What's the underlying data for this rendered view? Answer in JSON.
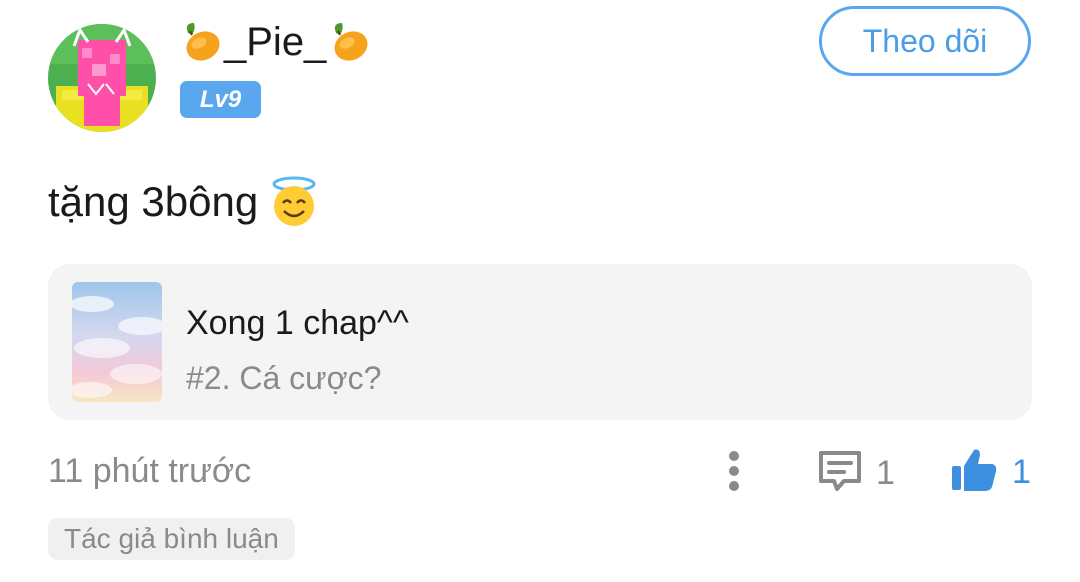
{
  "user": {
    "name": "_Pie_",
    "level": "Lv9"
  },
  "follow_button": {
    "label": "Theo dõi"
  },
  "post": {
    "text": "tặng 3bông"
  },
  "story": {
    "title": "Xong 1 chap^^",
    "chapter": "#2. Cá cược?"
  },
  "meta": {
    "time_ago": "11 phút trước",
    "comment_count": "1",
    "like_count": "1",
    "author_tag": "Tác giả bình luận"
  },
  "icons": {
    "name_decoration": "mango-icon",
    "post_emoji": "smiling-face-with-halo-icon",
    "more": "vertical-dots-icon",
    "comment": "comment-icon",
    "like": "thumbs-up-icon"
  },
  "colors": {
    "accent": "#5aa7ef",
    "like": "#3d8fe0",
    "muted_text": "#8a8a8a",
    "card_bg": "#f4f4f4"
  }
}
